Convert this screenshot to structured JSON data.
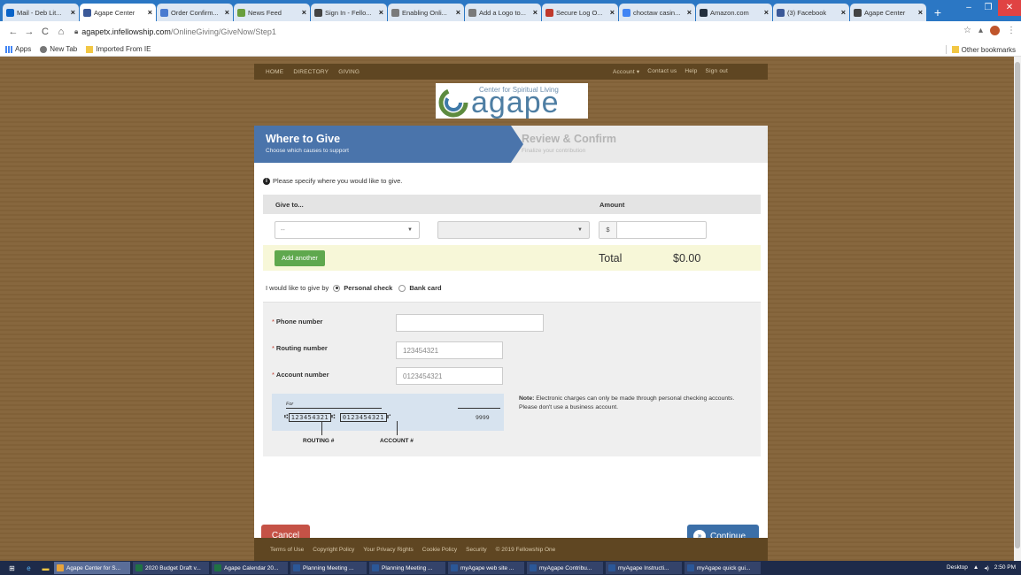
{
  "browser": {
    "tabs": [
      {
        "title": "Mail - Deb Lit...",
        "color": "#0a64c8",
        "active": false
      },
      {
        "title": "Agape Center",
        "color": "#3b5998",
        "active": true
      },
      {
        "title": "Order Confirm...",
        "color": "#4a7bd0",
        "active": false
      },
      {
        "title": "News Feed",
        "color": "#6a9e3c",
        "active": false
      },
      {
        "title": "Sign In - Fello...",
        "color": "#444444",
        "active": false
      },
      {
        "title": "Enabling Onli...",
        "color": "#7a7a7a",
        "active": false
      },
      {
        "title": "Add a Logo to...",
        "color": "#7a7a7a",
        "active": false
      },
      {
        "title": "Secure Log O...",
        "color": "#c0392b",
        "active": false
      },
      {
        "title": "choctaw casin...",
        "color": "#4285f4",
        "active": false
      },
      {
        "title": "Amazon.com",
        "color": "#232f3e",
        "active": false
      },
      {
        "title": "(3) Facebook",
        "color": "#3b5998",
        "active": false
      },
      {
        "title": "Agape Center",
        "color": "#444444",
        "active": false
      }
    ],
    "url_host": "agapetx.infellowship.com",
    "url_path": "/OnlineGiving/GiveNow/Step1",
    "bookmarks": [
      "Apps",
      "New Tab",
      "Imported From IE"
    ],
    "other_bookmarks": "Other bookmarks"
  },
  "site_nav": {
    "left": [
      "HOME",
      "DIRECTORY",
      "GIVING"
    ],
    "right": [
      "Account ▾",
      "Contact us",
      "Help",
      "Sign out"
    ]
  },
  "logo": {
    "tagline": "Center for Spiritual Living",
    "wordmark": "agape"
  },
  "steps": {
    "step1_title": "Where to Give",
    "step1_sub": "Choose which causes to support",
    "step2_title": "Review & Confirm",
    "step2_sub": "Finalize your contribution"
  },
  "info_text": "Please specify where you would like to give.",
  "give_table": {
    "col_give": "Give to...",
    "col_amount": "Amount",
    "fund_select": "--",
    "subfund_select": "",
    "currency": "$",
    "amount_value": ""
  },
  "add_another": "Add another",
  "total_label": "Total",
  "total_value": "$0.00",
  "pay_by": {
    "label": "I would like to give by",
    "options": [
      "Personal check",
      "Bank card"
    ],
    "selected": "Personal check"
  },
  "bank_form": {
    "phone_label": "Phone number",
    "phone_value": "",
    "routing_label": "Routing number",
    "routing_placeholder": "123454321",
    "account_label": "Account number",
    "account_placeholder": "0123454321",
    "required_mark": "*"
  },
  "check_image": {
    "for_text": "For",
    "routing_digits": "123454321",
    "account_digits": "0123454321",
    "check_number": "9999",
    "routing_label": "ROUTING #",
    "account_label": "ACCOUNT #"
  },
  "note": {
    "bold": "Note:",
    "text": "Electronic charges can only be made through personal checking accounts. Please don't use a business account."
  },
  "buttons": {
    "cancel": "Cancel",
    "continue": "Continue"
  },
  "footer_links": [
    "Terms of Use",
    "Copyright Policy",
    "Your Privacy Rights",
    "Cookie Policy",
    "Security",
    "© 2019 Fellowship One"
  ],
  "taskbar": {
    "items": [
      {
        "title": "Agape Center for S...",
        "color": "#e8a33a",
        "active": true
      },
      {
        "title": "2020 Budget Draft v...",
        "color": "#1f7244",
        "active": false
      },
      {
        "title": "Agape Calendar 20...",
        "color": "#1f7244",
        "active": false
      },
      {
        "title": "Planning Meeting ...",
        "color": "#2b5797",
        "active": false
      },
      {
        "title": "Planning Meeting ...",
        "color": "#2b5797",
        "active": false
      },
      {
        "title": "myAgape web site ...",
        "color": "#2b5797",
        "active": false
      },
      {
        "title": "myAgape Contribu...",
        "color": "#2b5797",
        "active": false
      },
      {
        "title": "myAgape Instructi...",
        "color": "#2b5797",
        "active": false
      },
      {
        "title": "myAgape quick gui...",
        "color": "#2b5797",
        "active": false
      }
    ],
    "desktop_label": "Desktop",
    "time": "2:50 PM"
  }
}
